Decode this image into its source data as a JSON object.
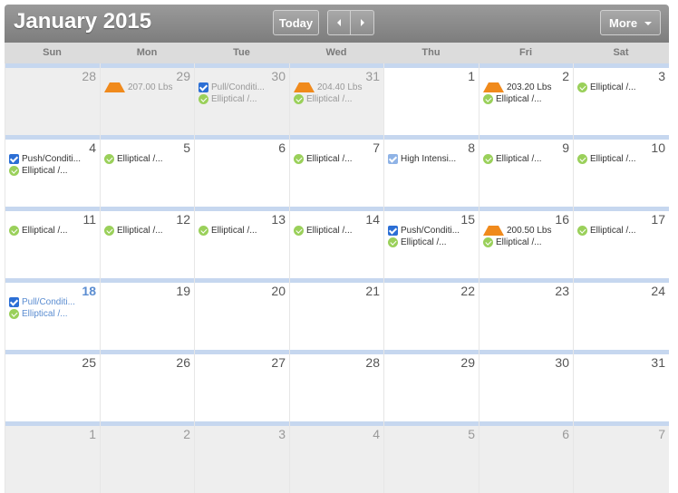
{
  "header": {
    "title": "January 2015",
    "today_label": "Today",
    "more_label": "More"
  },
  "days_of_week": [
    "Sun",
    "Mon",
    "Tue",
    "Wed",
    "Thu",
    "Fri",
    "Sat"
  ],
  "weeks": [
    [
      {
        "n": "28",
        "other": true,
        "events": []
      },
      {
        "n": "29",
        "other": true,
        "events": [
          {
            "icon": "weight-icon",
            "text": "207.00 Lbs"
          }
        ]
      },
      {
        "n": "30",
        "other": true,
        "events": [
          {
            "icon": "checkbox-icon",
            "text": "Pull/Conditi..."
          },
          {
            "icon": "completed-icon",
            "text": "Elliptical /..."
          }
        ]
      },
      {
        "n": "31",
        "other": true,
        "events": [
          {
            "icon": "weight-icon",
            "text": "204.40 Lbs"
          },
          {
            "icon": "completed-icon",
            "text": "Elliptical /..."
          }
        ]
      },
      {
        "n": "1",
        "events": []
      },
      {
        "n": "2",
        "events": [
          {
            "icon": "weight-icon",
            "text": "203.20 Lbs"
          },
          {
            "icon": "completed-icon",
            "text": "Elliptical /..."
          }
        ]
      },
      {
        "n": "3",
        "events": [
          {
            "icon": "completed-icon",
            "text": "Elliptical /..."
          }
        ]
      }
    ],
    [
      {
        "n": "4",
        "events": [
          {
            "icon": "checkbox-icon",
            "text": "Push/Conditi..."
          },
          {
            "icon": "completed-icon",
            "text": "Elliptical /..."
          }
        ]
      },
      {
        "n": "5",
        "events": [
          {
            "icon": "completed-icon",
            "text": "Elliptical /..."
          }
        ]
      },
      {
        "n": "6",
        "events": []
      },
      {
        "n": "7",
        "events": [
          {
            "icon": "completed-icon",
            "text": "Elliptical /..."
          }
        ]
      },
      {
        "n": "8",
        "events": [
          {
            "icon": "checkbox-icon",
            "light": true,
            "text": "High Intensi..."
          }
        ]
      },
      {
        "n": "9",
        "events": [
          {
            "icon": "completed-icon",
            "text": "Elliptical /..."
          }
        ]
      },
      {
        "n": "10",
        "events": [
          {
            "icon": "completed-icon",
            "text": "Elliptical /..."
          }
        ]
      }
    ],
    [
      {
        "n": "11",
        "events": [
          {
            "icon": "completed-icon",
            "text": "Elliptical /..."
          }
        ]
      },
      {
        "n": "12",
        "events": [
          {
            "icon": "completed-icon",
            "text": "Elliptical /..."
          }
        ]
      },
      {
        "n": "13",
        "events": [
          {
            "icon": "completed-icon",
            "text": "Elliptical /..."
          }
        ]
      },
      {
        "n": "14",
        "events": [
          {
            "icon": "completed-icon",
            "text": "Elliptical /..."
          }
        ]
      },
      {
        "n": "15",
        "events": [
          {
            "icon": "checkbox-icon",
            "text": "Push/Conditi..."
          },
          {
            "icon": "completed-icon",
            "text": "Elliptical /..."
          }
        ]
      },
      {
        "n": "16",
        "events": [
          {
            "icon": "weight-icon",
            "text": "200.50 Lbs"
          },
          {
            "icon": "completed-icon",
            "text": "Elliptical /..."
          }
        ]
      },
      {
        "n": "17",
        "events": [
          {
            "icon": "completed-icon",
            "text": "Elliptical /..."
          }
        ]
      }
    ],
    [
      {
        "n": "18",
        "today": true,
        "events": [
          {
            "icon": "checkbox-icon",
            "text": "Pull/Conditi..."
          },
          {
            "icon": "completed-icon",
            "text": "Elliptical /..."
          }
        ]
      },
      {
        "n": "19",
        "events": []
      },
      {
        "n": "20",
        "events": []
      },
      {
        "n": "21",
        "events": []
      },
      {
        "n": "22",
        "events": []
      },
      {
        "n": "23",
        "events": []
      },
      {
        "n": "24",
        "events": []
      }
    ],
    [
      {
        "n": "25",
        "events": []
      },
      {
        "n": "26",
        "events": []
      },
      {
        "n": "27",
        "events": []
      },
      {
        "n": "28",
        "events": []
      },
      {
        "n": "29",
        "events": []
      },
      {
        "n": "30",
        "events": []
      },
      {
        "n": "31",
        "events": []
      }
    ],
    [
      {
        "n": "1",
        "other": true,
        "events": []
      },
      {
        "n": "2",
        "other": true,
        "events": []
      },
      {
        "n": "3",
        "other": true,
        "events": []
      },
      {
        "n": "4",
        "other": true,
        "events": []
      },
      {
        "n": "5",
        "other": true,
        "events": []
      },
      {
        "n": "6",
        "other": true,
        "events": []
      },
      {
        "n": "7",
        "other": true,
        "events": []
      }
    ]
  ]
}
